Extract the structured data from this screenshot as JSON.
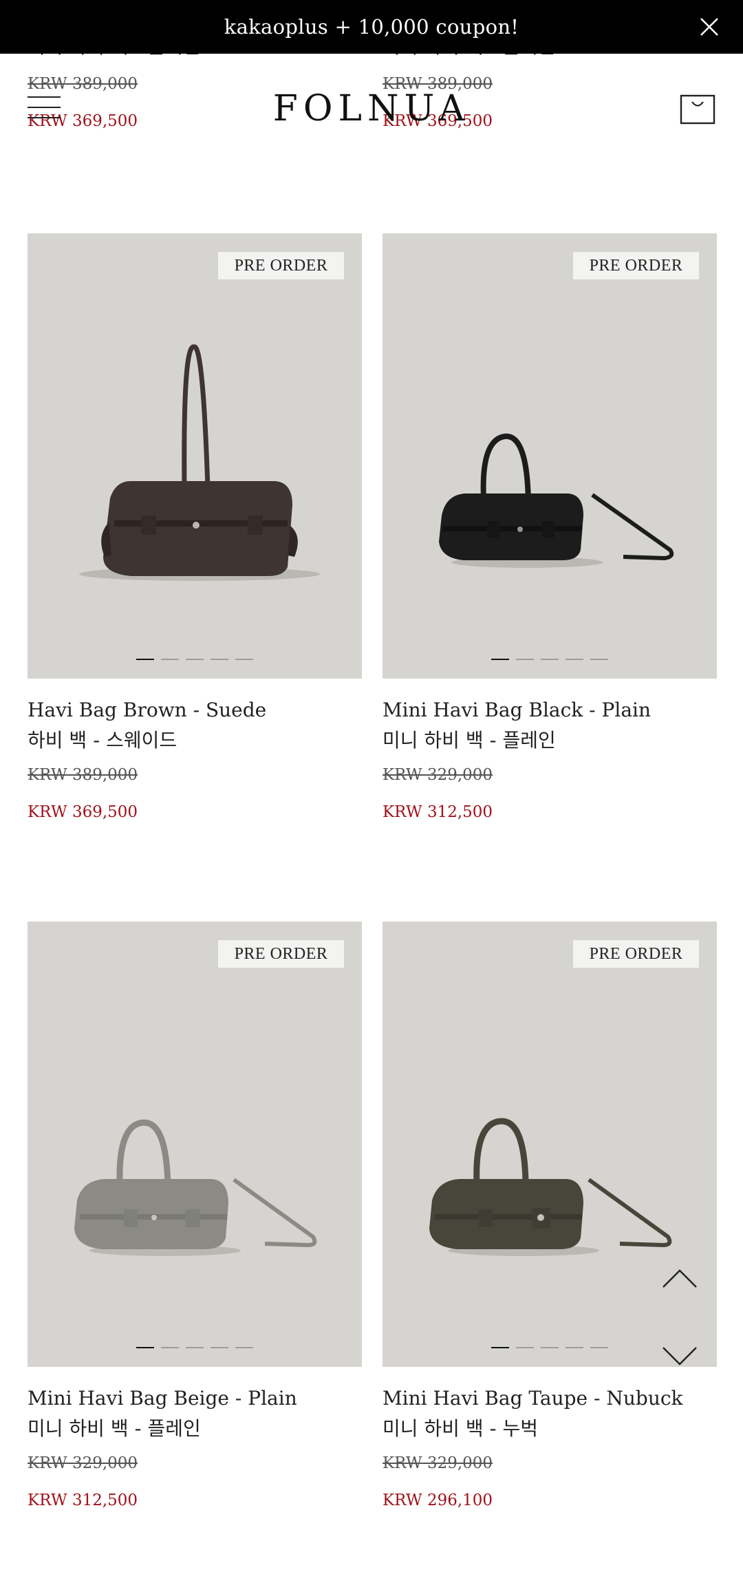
{
  "banner": {
    "text": "kakaoplus + 10,000 coupon!",
    "close_icon": "close-icon"
  },
  "header": {
    "logo": "FOLNUA",
    "menu_icon": "hamburger-menu-icon",
    "cart_icon": "shopping-bag-icon"
  },
  "previous_row": [
    {
      "name_ko": "미니 하비 백 - 플레인",
      "original_price": "KRW 389,000",
      "sale_price": "KRW 369,500"
    },
    {
      "name_ko": "미니 하비 백 - 플레인",
      "original_price": "KRW 389,000",
      "sale_price": "KRW 369,500"
    }
  ],
  "products": [
    {
      "badge": "PRE ORDER",
      "name_en": "Havi Bag Brown - Suede",
      "name_ko": "하비 백 - 스웨이드",
      "original_price": "KRW 389,000",
      "sale_price": "KRW 369,500",
      "image_dots": 5,
      "active_dot": 1
    },
    {
      "badge": "PRE ORDER",
      "name_en": "Mini Havi Bag Black - Plain",
      "name_ko": "미니 하비 백 - 플레인",
      "original_price": "KRW 329,000",
      "sale_price": "KRW 312,500",
      "image_dots": 5,
      "active_dot": 1
    },
    {
      "badge": "PRE ORDER",
      "name_en": "Mini Havi Bag Beige - Plain",
      "name_ko": "미니 하비 백 - 플레인",
      "original_price": "KRW 329,000",
      "sale_price": "KRW 312,500",
      "image_dots": 5,
      "active_dot": 1
    },
    {
      "badge": "PRE ORDER",
      "name_en": "Mini Havi Bag Taupe - Nubuck",
      "name_ko": "미니 하비 백 - 누벅",
      "original_price": "KRW 329,000",
      "sale_price": "KRW 296,100",
      "image_dots": 5,
      "active_dot": 1
    }
  ],
  "colors": {
    "sale_price": "#a0121b",
    "photo_bg": "#d5d4d0",
    "banner_bg": "#000000",
    "bag_brown": "#3e3431",
    "bag_black": "#1c1c1c",
    "bag_beige": "#8b8a84",
    "bag_taupe": "#48463b"
  },
  "scroll_controls": {
    "up_icon": "chevron-up-icon",
    "down_icon": "chevron-down-icon"
  }
}
